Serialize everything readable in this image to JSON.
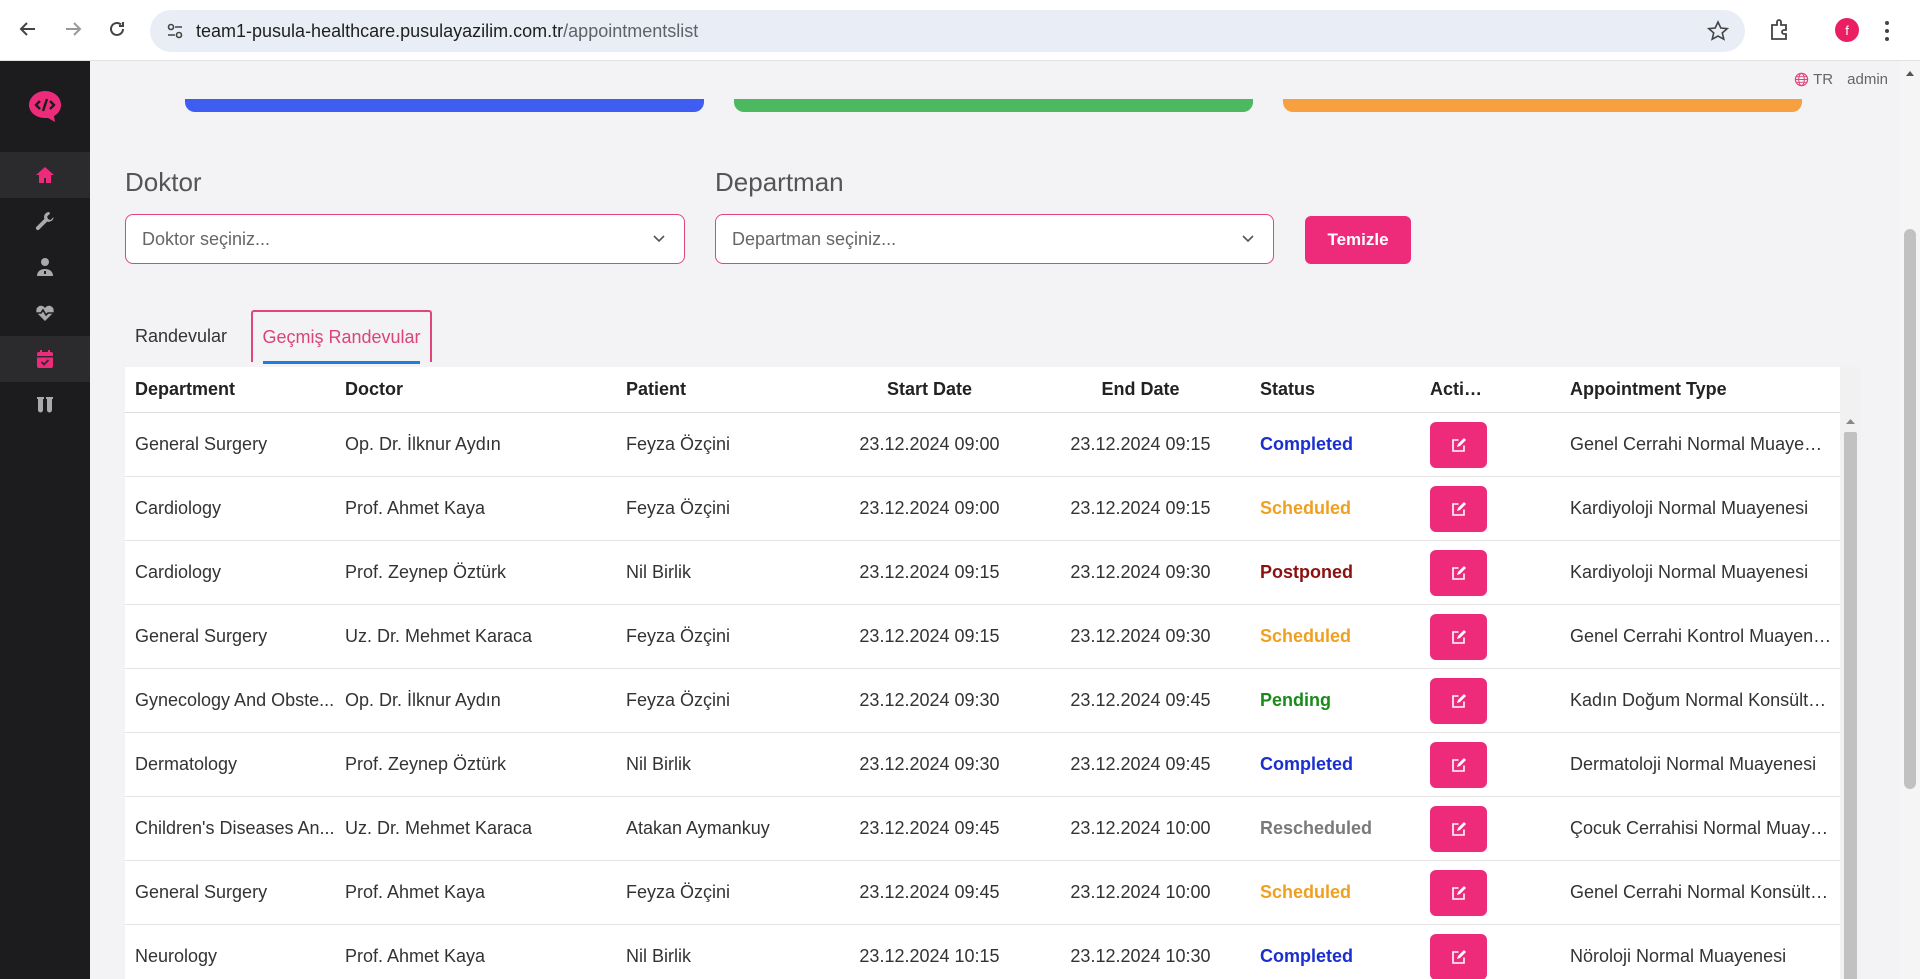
{
  "browser": {
    "url_host": "team1-pusula-healthcare.pusulayazilim.com.tr",
    "url_path": "/appointmentslist",
    "profile_initial": "f"
  },
  "topbar": {
    "language": "TR",
    "user": "admin"
  },
  "filters": {
    "doctor_label": "Doktor",
    "doctor_placeholder": "Doktor seçiniz...",
    "department_label": "Departman",
    "department_placeholder": "Departman seçiniz...",
    "clear_label": "Temizle"
  },
  "tabs": [
    {
      "label": "Randevular"
    },
    {
      "label": "Geçmiş Randevular"
    }
  ],
  "table": {
    "headers": {
      "department": "Department",
      "doctor": "Doctor",
      "patient": "Patient",
      "start": "Start Date",
      "end": "End Date",
      "status": "Status",
      "actions": "Actions",
      "type": "Appointment Type"
    },
    "rows": [
      {
        "department": "General Surgery",
        "doctor": "Op. Dr. İlknur Aydın",
        "patient": "Feyza Özçini",
        "start": "23.12.2024 09:00",
        "end": "23.12.2024 09:15",
        "status": "Completed",
        "type": "Genel Cerrahi Normal Muayenesi"
      },
      {
        "department": "Cardiology",
        "doctor": "Prof. Ahmet Kaya",
        "patient": "Feyza Özçini",
        "start": "23.12.2024 09:00",
        "end": "23.12.2024 09:15",
        "status": "Scheduled",
        "type": "Kardiyoloji Normal Muayenesi"
      },
      {
        "department": "Cardiology",
        "doctor": "Prof. Zeynep Öztürk",
        "patient": "Nil Birlik",
        "start": "23.12.2024 09:15",
        "end": "23.12.2024 09:30",
        "status": "Postponed",
        "type": "Kardiyoloji Normal Muayenesi"
      },
      {
        "department": "General Surgery",
        "doctor": "Uz. Dr. Mehmet Karaca",
        "patient": "Feyza Özçini",
        "start": "23.12.2024 09:15",
        "end": "23.12.2024 09:30",
        "status": "Scheduled",
        "type": "Genel Cerrahi Kontrol Muayenesi"
      },
      {
        "department": "Gynecology And Obste...",
        "doctor": "Op. Dr. İlknur Aydın",
        "patient": "Feyza Özçini",
        "start": "23.12.2024 09:30",
        "end": "23.12.2024 09:45",
        "status": "Pending",
        "type": "Kadın Doğum Normal Konsültas..."
      },
      {
        "department": "Dermatology",
        "doctor": "Prof. Zeynep Öztürk",
        "patient": "Nil Birlik",
        "start": "23.12.2024 09:30",
        "end": "23.12.2024 09:45",
        "status": "Completed",
        "type": "Dermatoloji Normal Muayenesi"
      },
      {
        "department": "Children's Diseases An...",
        "doctor": "Uz. Dr. Mehmet Karaca",
        "patient": "Atakan Aymankuy",
        "start": "23.12.2024 09:45",
        "end": "23.12.2024 10:00",
        "status": "Rescheduled",
        "type": "Çocuk Cerrahisi Normal Muayen..."
      },
      {
        "department": "General Surgery",
        "doctor": "Prof. Ahmet Kaya",
        "patient": "Feyza Özçini",
        "start": "23.12.2024 09:45",
        "end": "23.12.2024 10:00",
        "status": "Scheduled",
        "type": "Genel Cerrahi Normal Konsültas..."
      },
      {
        "department": "Neurology",
        "doctor": "Prof. Ahmet Kaya",
        "patient": "Nil Birlik",
        "start": "23.12.2024 10:15",
        "end": "23.12.2024 10:30",
        "status": "Completed",
        "type": "Nöroloji Normal Muayenesi"
      }
    ]
  },
  "status_colors": {
    "Completed": "#1a2fd0",
    "Scheduled": "#f0a020",
    "Postponed": "#8b1010",
    "Pending": "#1a8a1a",
    "Rescheduled": "#7a7a7a"
  },
  "theme": {
    "accent": "#ee2a7b",
    "sidebar_bg": "#1c1c1e",
    "card_blue": "#3d5ef0",
    "card_green": "#4cb860",
    "card_orange": "#f7a040"
  }
}
